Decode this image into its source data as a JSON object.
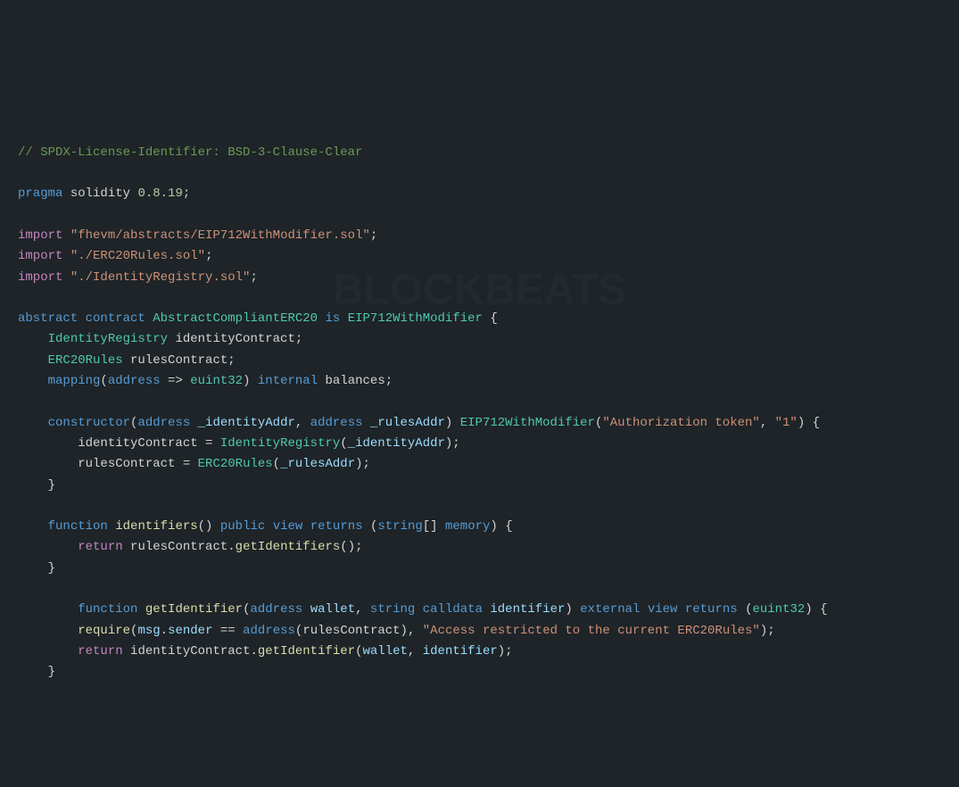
{
  "code": {
    "line1_comment": "// SPDX-License-Identifier: BSD-3-Clause-Clear",
    "line3_pragma_kw": "pragma",
    "line3_solidity": "solidity",
    "line3_version": "0.8.19",
    "line5_import_kw": "import",
    "line5_path": "\"fhevm/abstracts/EIP712WithModifier.sol\"",
    "line6_import_kw": "import",
    "line6_path": "\"./ERC20Rules.sol\"",
    "line7_import_kw": "import",
    "line7_path": "\"./IdentityRegistry.sol\"",
    "line9_abstract": "abstract",
    "line9_contract": "contract",
    "line9_name": "AbstractCompliantERC20",
    "line9_is": "is",
    "line9_parent": "EIP712WithModifier",
    "line10_type": "IdentityRegistry",
    "line10_var": "identityContract",
    "line11_type": "ERC20Rules",
    "line11_var": "rulesContract",
    "line12_mapping": "mapping",
    "line12_address": "address",
    "line12_euint32": "euint32",
    "line12_internal": "internal",
    "line12_balances": "balances",
    "line14_constructor": "constructor",
    "line14_address1": "address",
    "line14_param1": "_identityAddr",
    "line14_address2": "address",
    "line14_param2": "_rulesAddr",
    "line14_modifier": "EIP712WithModifier",
    "line14_str1": "\"Authorization token\"",
    "line14_str2": "\"1\"",
    "line15_var": "identityContract",
    "line15_type": "IdentityRegistry",
    "line15_arg": "_identityAddr",
    "line16_var": "rulesContract",
    "line16_type": "ERC20Rules",
    "line16_arg": "_rulesAddr",
    "line19_function": "function",
    "line19_name": "identifiers",
    "line19_public": "public",
    "line19_view": "view",
    "line19_returns": "returns",
    "line19_string": "string",
    "line19_memory": "memory",
    "line20_return": "return",
    "line20_var": "rulesContract",
    "line20_method": "getIdentifiers",
    "line23_function": "function",
    "line23_name": "getIdentifier",
    "line23_address": "address",
    "line23_wallet": "wallet",
    "line23_string": "string",
    "line23_calldata": "calldata",
    "line23_identifier": "identifier",
    "line23_external": "external",
    "line23_view": "view",
    "line23_returns": "returns",
    "line23_euint32": "euint32",
    "line24_require": "require",
    "line24_msg": "msg",
    "line24_sender": "sender",
    "line24_address": "address",
    "line24_rules": "rulesContract",
    "line24_str": "\"Access restricted to the current ERC20Rules\"",
    "line25_return": "return",
    "line25_var": "identityContract",
    "line25_method": "getIdentifier",
    "line25_arg1": "wallet",
    "line25_arg2": "identifier"
  },
  "watermark": "BLOCKBEATS"
}
